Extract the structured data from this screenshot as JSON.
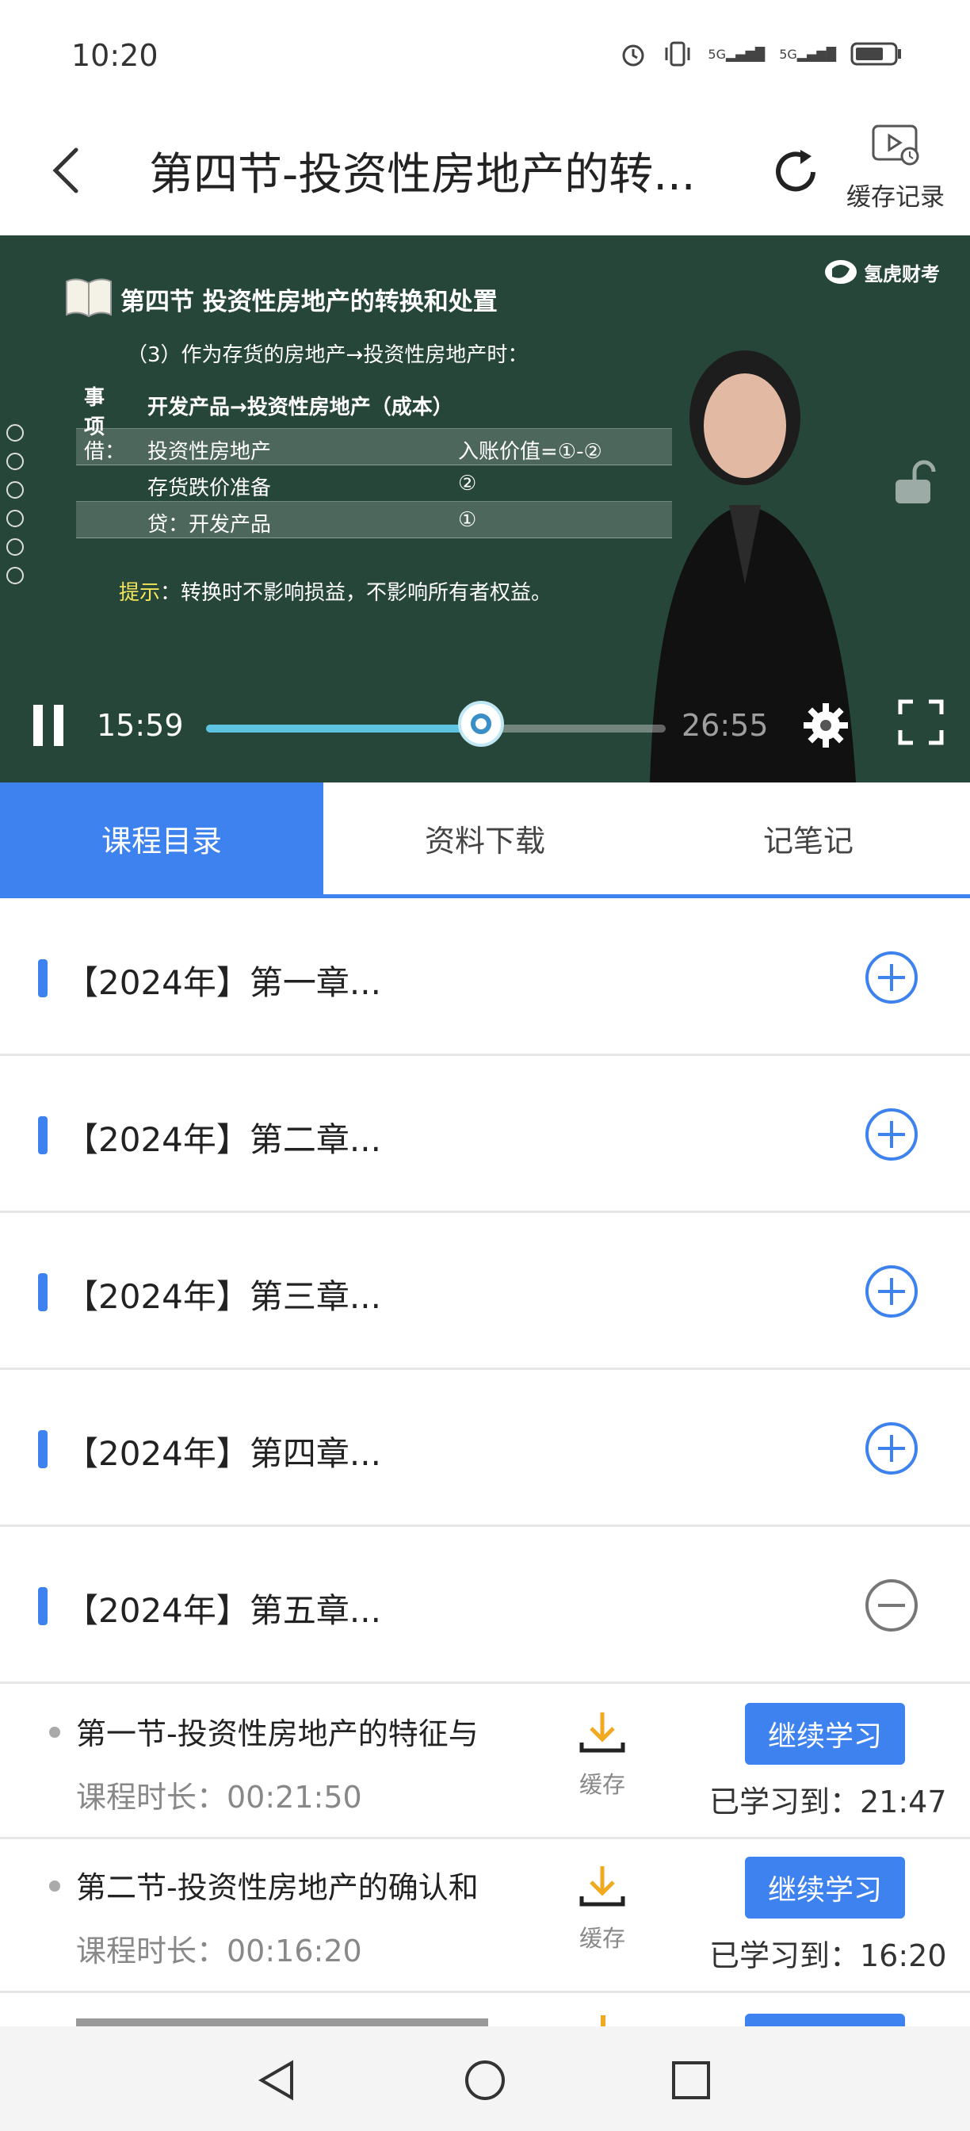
{
  "status_bar": {
    "time": "10:20",
    "signal1": "5G",
    "signal2": "5G"
  },
  "header": {
    "title": "第四节-投资性房地产的转...",
    "cache_record_label": "缓存记录"
  },
  "video": {
    "slide_title": "第四节 投资性房地产的转换和处置",
    "slide_subtitle": "（3）作为存货的房地产→投资性房地产时：",
    "table": {
      "header": [
        "事项",
        "开发产品→投资性房地产（成本）"
      ],
      "rows": [
        [
          "借：",
          "投资性房地产",
          "入账价值=①-②"
        ],
        [
          "",
          "存货跌价准备",
          "②"
        ],
        [
          "",
          "贷：开发产品",
          "①"
        ]
      ]
    },
    "tip_label": "提示",
    "tip_text": "：转换时不影响损益，不影响所有者权益。",
    "logo_text": "氢虎财考",
    "current_time": "15:59",
    "total_time": "26:55",
    "progress_fraction": 0.598
  },
  "tabs": [
    "课程目录",
    "资料下载",
    "记笔记"
  ],
  "chapters": [
    {
      "label": "【2024年】第一章...",
      "state": "collapsed"
    },
    {
      "label": "【2024年】第二章...",
      "state": "collapsed"
    },
    {
      "label": "【2024年】第三章...",
      "state": "collapsed"
    },
    {
      "label": "【2024年】第四章...",
      "state": "collapsed"
    },
    {
      "label": "【2024年】第五章...",
      "state": "expanded"
    }
  ],
  "lessons": [
    {
      "title": "第一节-投资性房地产的特征与",
      "duration": "课程时长：00:21:50",
      "download_label": "缓存",
      "continue_label": "继续学习",
      "learned": "已学习到：21:47"
    },
    {
      "title": "第二节-投资性房地产的确认和",
      "duration": "课程时长：00:16:20",
      "download_label": "缓存",
      "continue_label": "继续学习",
      "learned": "已学习到：16:20"
    }
  ],
  "colors": {
    "accent": "#3d82ee",
    "board": "#27463a",
    "download": "#f1a91f"
  }
}
